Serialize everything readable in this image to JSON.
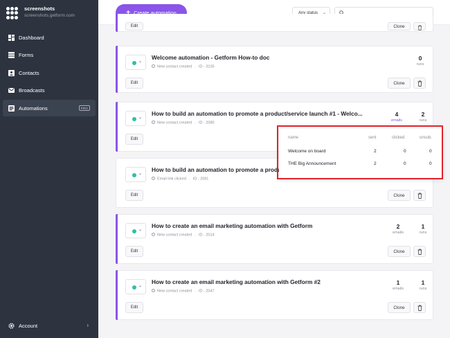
{
  "brand": {
    "name": "screenshots",
    "url": "screenshots.getform.com"
  },
  "nav": {
    "items": [
      {
        "label": "Dashboard",
        "icon": "dashboard-icon"
      },
      {
        "label": "Forms",
        "icon": "forms-icon"
      },
      {
        "label": "Contacts",
        "icon": "contacts-icon"
      },
      {
        "label": "Broadcasts",
        "icon": "broadcasts-icon"
      },
      {
        "label": "Automations",
        "icon": "automations-icon",
        "active": true,
        "badge": "PRO"
      }
    ],
    "account": "Account"
  },
  "topbar": {
    "create_label": "Create automation",
    "status_filter": "Any status",
    "search_placeholder": ""
  },
  "cards": [
    {
      "clone": "Clone",
      "edit": "Edit"
    },
    {
      "title": "Welcome automation - Getform How-to doc",
      "trigger": "New contact created",
      "id": "ID - 3105",
      "runs": "0",
      "runs_label": "runs",
      "edit": "Edit",
      "clone": "Clone"
    },
    {
      "title": "How to build an automation to promote a product/service launch #1 - Welco...",
      "trigger": "New contact created",
      "id": "ID - 2080",
      "emails": "4",
      "emails_label": "emails",
      "runs": "2",
      "runs_label": "runs",
      "edit": "Edit"
    },
    {
      "title": "How to build an automation to promote a produc",
      "trigger": "Email link clicked",
      "id": "ID - 2081",
      "edit": "Edit",
      "clone": "Clone"
    },
    {
      "title": "How to create an email marketing automation with Getform",
      "trigger": "New contact created",
      "id": "ID - 2014",
      "emails": "2",
      "emails_label": "emails",
      "runs": "1",
      "runs_label": "runs",
      "edit": "Edit",
      "clone": "Clone"
    },
    {
      "title": "How to create an email marketing automation with Getform #2",
      "trigger": "New contact created",
      "id": "ID - 2047",
      "emails": "1",
      "emails_label": "emails",
      "runs": "1",
      "runs_label": "runs",
      "edit": "Edit",
      "clone": "Clone"
    }
  ],
  "popup": {
    "headers": {
      "name": "name",
      "sent": "sent",
      "clicked": "clicked",
      "unsub": "unsub."
    },
    "rows": [
      {
        "name": "Welcome on board",
        "sent": "2",
        "clicked": "0",
        "unsub": "0"
      },
      {
        "name": "THE Big Announcement",
        "sent": "2",
        "clicked": "0",
        "unsub": "0"
      }
    ]
  },
  "colors": {
    "accent": "#8a55e8",
    "sidebar": "#2d3440",
    "status_dot": "#2cc0a8",
    "highlight": "#e0232a"
  }
}
